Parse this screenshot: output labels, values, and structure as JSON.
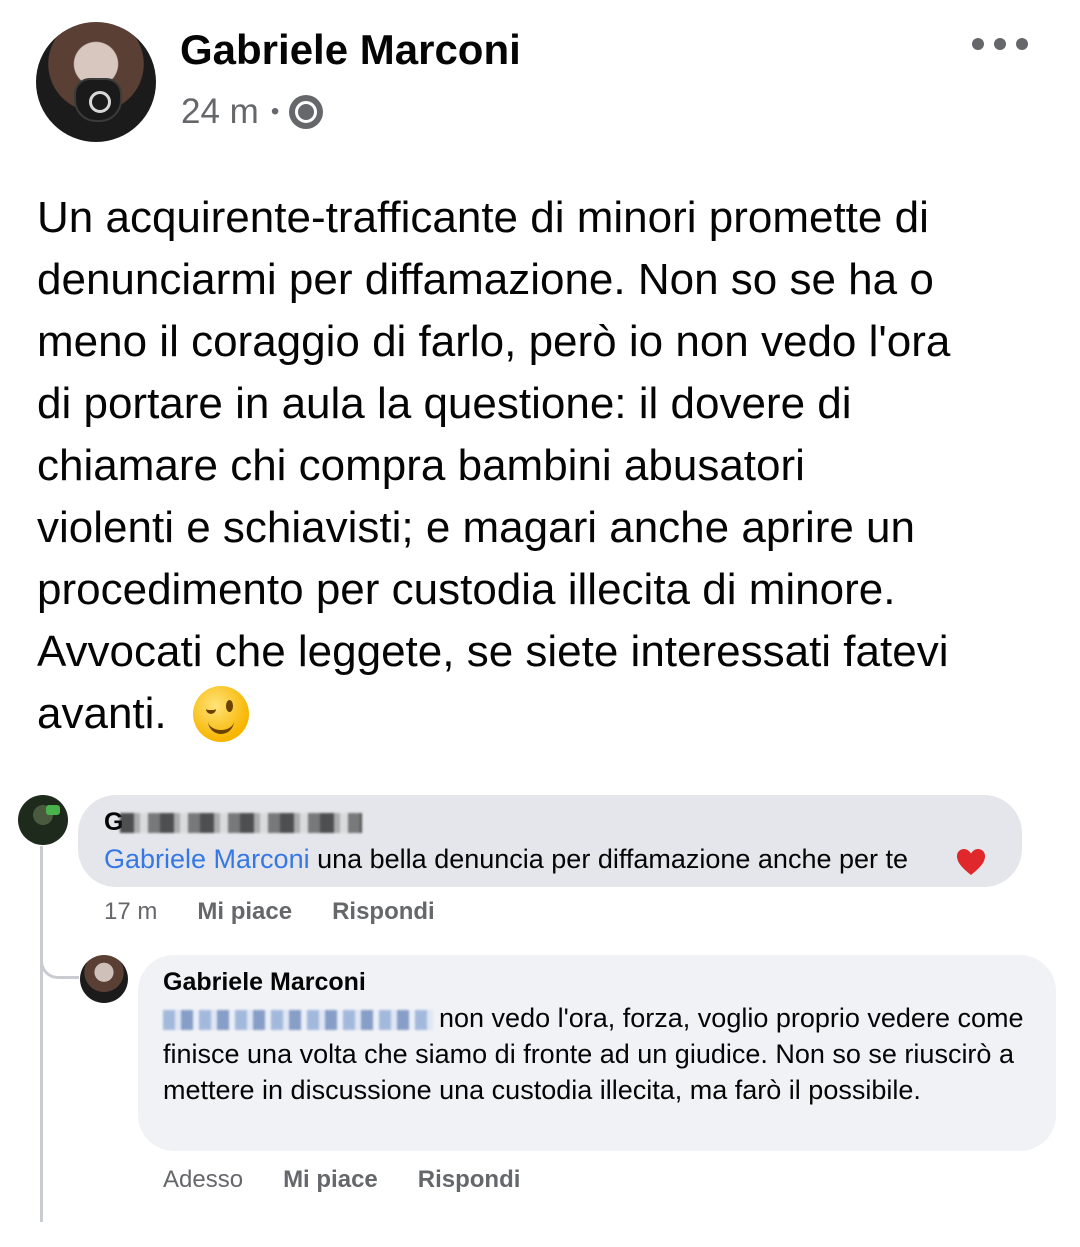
{
  "post": {
    "author": "Gabriele Marconi",
    "time": "24 m",
    "separator": "•",
    "privacy_icon": "globe-icon",
    "more_icon": "more-options-icon",
    "text": "Un acquirente-trafficante di minori promette di\ndenunciarmi per diffamazione. Non so se ha o\nmeno il coraggio di farlo, però io non vedo l'ora\ndi portare in aula la questione: il dovere di\nchiamare chi compra bambini abusatori\nviolenti e schiavisti; e magari anche aprire un\nprocedimento per custodia illecita di minore.\nAvvocati che leggete, se siete interessati fatevi\navanti.",
    "emoji": "wink-emoji"
  },
  "comments": [
    {
      "author_visible_initial": "G",
      "mention": "Gabriele Marconi",
      "text": " una bella denuncia per diffamazione anche per te",
      "emoji": "heart-emoji",
      "time": "17 m",
      "like": "Mi piace",
      "reply": "Rispondi"
    },
    {
      "author": "Gabriele Marconi",
      "text": "non vedo l'ora, forza, voglio proprio vedere come finisce una volta che siamo di fronte ad un giudice. Non so se riuscirò a mettere in discussione una custodia illecita, ma farò il possibile.",
      "time": "Adesso",
      "like": "Mi piace",
      "reply": "Rispondi"
    }
  ]
}
